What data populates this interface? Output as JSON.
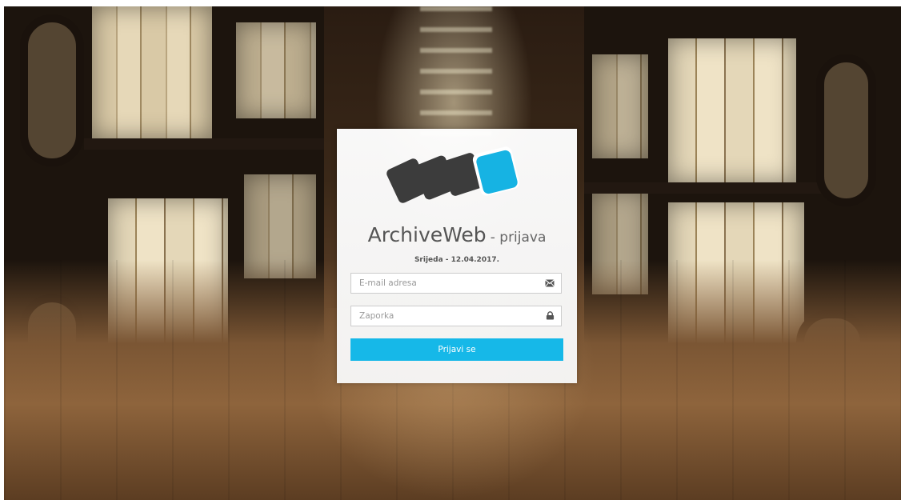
{
  "app": {
    "title": "ArchiveWeb",
    "subtitle": "- prijava",
    "date": "Srijeda - 12.04.2017."
  },
  "login": {
    "email_placeholder": "E-mail adresa",
    "email_value": "",
    "password_placeholder": "Zaporka",
    "password_value": "",
    "submit_label": "Prijavi se"
  },
  "icons": {
    "email": "envelope-icon",
    "password": "lock-icon",
    "logo": "archiveweb-logo"
  },
  "colors": {
    "accent": "#16b8e8",
    "logo_dark": "#3c3c3c",
    "logo_blue": "#16b3e3",
    "text": "#555555"
  }
}
